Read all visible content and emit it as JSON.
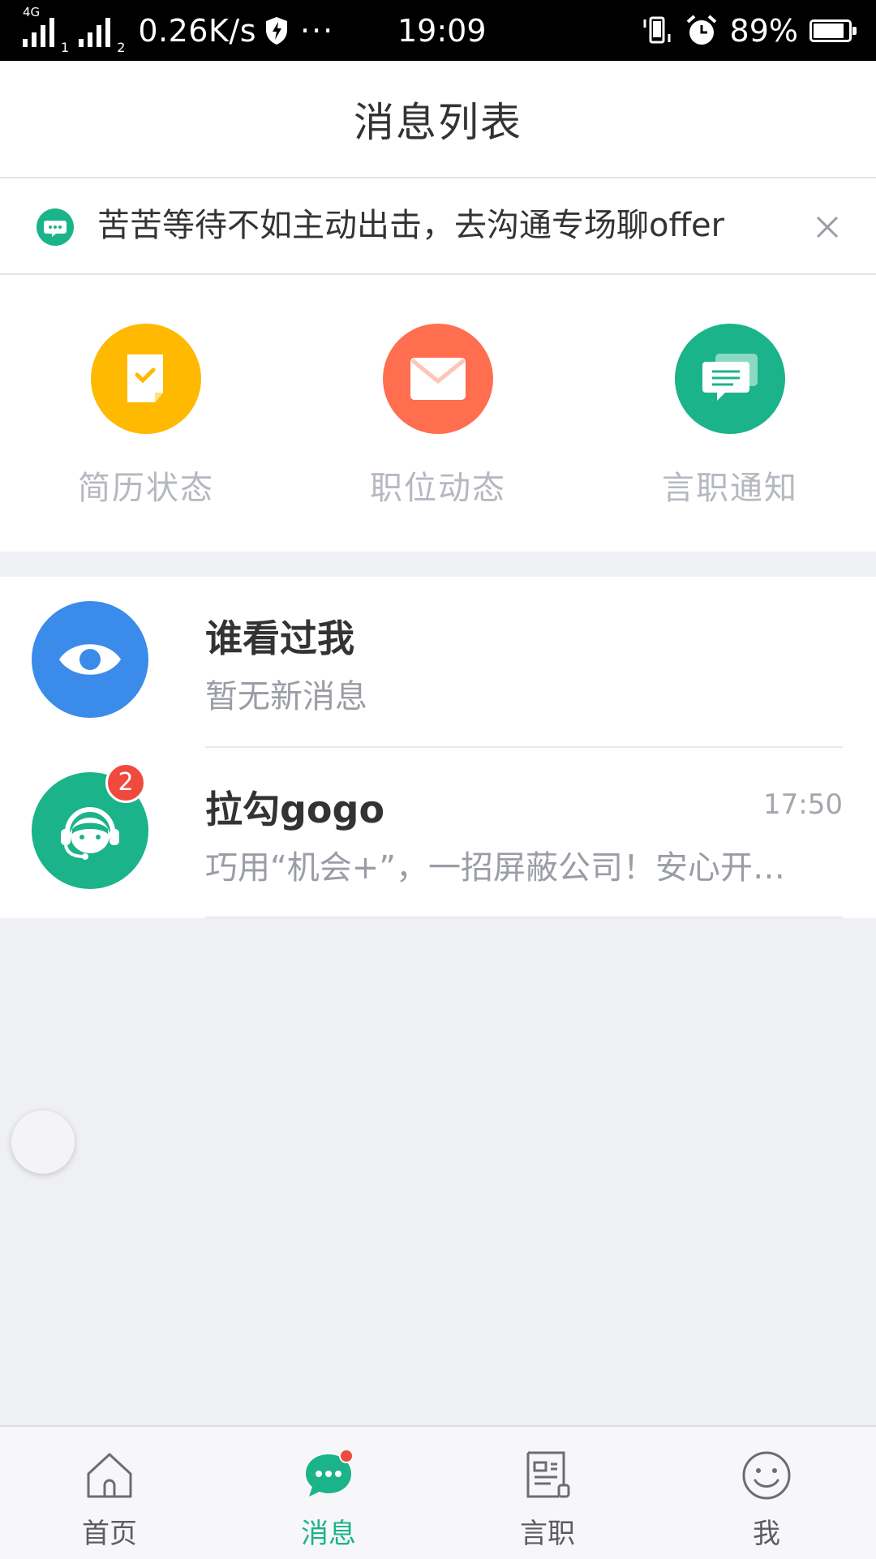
{
  "status_bar": {
    "network": "4G",
    "sim1": "1",
    "sim2": "2",
    "speed": "0.26K/s",
    "more": "···",
    "time": "19:09",
    "battery_pct": "89%",
    "battery_level": 0.89
  },
  "header": {
    "title": "消息列表"
  },
  "banner": {
    "text": "苦苦等待不如主动出击，去沟通专场聊offer",
    "accent": "#1bb38a"
  },
  "categories": [
    {
      "label": "简历状态",
      "icon": "resume-icon",
      "color": "#ffb900"
    },
    {
      "label": "职位动态",
      "icon": "mail-icon",
      "color": "#ff6e4e"
    },
    {
      "label": "言职通知",
      "icon": "chat-notice-icon",
      "color": "#1bb38a"
    }
  ],
  "messages": [
    {
      "title": "谁看过我",
      "subtitle": "暂无新消息",
      "time": "",
      "icon": "eye-icon",
      "color": "#3b8bea"
    },
    {
      "title": "拉勾gogo",
      "subtitle": "巧用“机会+”，一招屏蔽公司！安心开…",
      "time": "17:50",
      "badge": "2",
      "icon": "support-agent-icon",
      "color": "#1bb38a"
    }
  ],
  "tabbar": {
    "active": 1,
    "items": [
      {
        "label": "首页",
        "icon": "home-icon"
      },
      {
        "label": "消息",
        "icon": "message-icon"
      },
      {
        "label": "言职",
        "icon": "document-icon"
      },
      {
        "label": "我",
        "icon": "smiley-icon"
      }
    ]
  },
  "colors": {
    "accent": "#1bb38a",
    "badge": "#f04a3e"
  }
}
